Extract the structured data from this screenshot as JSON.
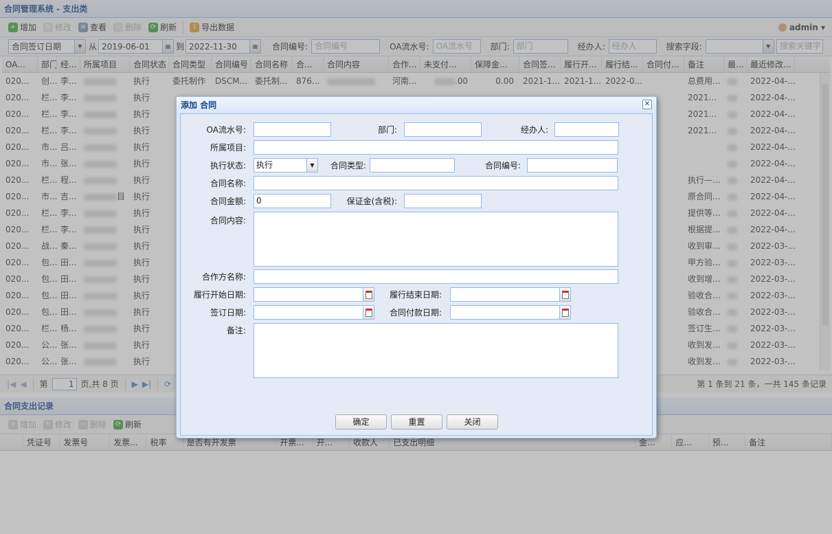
{
  "top_panel": {
    "title": "合同管理系统 - 支出类"
  },
  "toolbar": {
    "items": [
      {
        "label": "增加",
        "icon": "plus-icon",
        "color": "#3aa53a",
        "disabled": false
      },
      {
        "label": "修改",
        "icon": "pencil-icon",
        "color": "#d9b440",
        "disabled": true
      },
      {
        "label": "查看",
        "icon": "view-icon",
        "color": "#7a8fb0",
        "disabled": false
      },
      {
        "label": "删除",
        "icon": "minus-icon",
        "color": "#e07070",
        "disabled": true
      },
      {
        "label": "刷新",
        "icon": "refresh-icon",
        "color": "#3aa53a",
        "disabled": false
      },
      {
        "label": "导出数据",
        "icon": "export-icon",
        "color": "#d9a030",
        "disabled": false
      }
    ],
    "user": "admin ▾"
  },
  "search": {
    "date_field": "合同签订日期",
    "from_label": "从",
    "from_date": "2019-06-01",
    "to_label": "到",
    "to_date": "2022-11-30",
    "contract_no_label": "合同编号:",
    "contract_no_ph": "合同编号",
    "oa_label": "OA流水号:",
    "oa_ph": "OA流水号",
    "dept_label": "部门:",
    "dept_ph": "部门",
    "handler_label": "经办人:",
    "handler_ph": "经办人",
    "field_label": "搜索字段:",
    "keyword_ph": "搜索关键字"
  },
  "grid": {
    "columns": [
      "OA...",
      "部门",
      "经...",
      "所属项目",
      "合同状态",
      "合同类型",
      "合同编号",
      "合同名称",
      "合...",
      "合同内容",
      "合作...",
      "未支付...",
      "保障金...",
      "合同签...",
      "履行开...",
      "履行结...",
      "合同付...",
      "备注",
      "最...",
      "最近修改..."
    ],
    "rows": [
      [
        "020...",
        "创...",
        "李...",
        "",
        "执行",
        "委托制作",
        "DSCM...",
        "委托制...",
        "876...",
        "",
        "河南...",
        ".00",
        "0.00",
        "2021-1...",
        "2021-1...",
        "2022-0...",
        "",
        "总费用...",
        "",
        "2022-04-..."
      ],
      [
        "020...",
        "栏...",
        "李...",
        "",
        "执行",
        "",
        "",
        "",
        "",
        "",
        "",
        "",
        "",
        "",
        "",
        "",
        "",
        "2021...",
        "",
        "2022-04-..."
      ],
      [
        "020...",
        "栏...",
        "李...",
        "",
        "执行",
        "",
        "",
        "",
        "",
        "",
        "",
        "",
        "",
        "",
        "",
        "",
        "",
        "2021...",
        "",
        "2022-04-..."
      ],
      [
        "020...",
        "栏...",
        "李...",
        "",
        "执行",
        "",
        "",
        "",
        "",
        "",
        "",
        "",
        "",
        "",
        "",
        "",
        "",
        "2021...",
        "",
        "2022-04-..."
      ],
      [
        "020...",
        "市...",
        "吕...",
        "",
        "执行",
        "",
        "",
        "",
        "",
        "",
        "",
        "",
        "",
        "",
        "",
        "",
        "",
        "",
        "",
        "2022-04-..."
      ],
      [
        "020...",
        "市...",
        "张...",
        "",
        "执行",
        "",
        "",
        "",
        "",
        "",
        "",
        "",
        "",
        "",
        "",
        "",
        "",
        "",
        "",
        "2022-04-..."
      ],
      [
        "020...",
        "栏...",
        "程...",
        "",
        "执行",
        "",
        "",
        "",
        "",
        "",
        "",
        "",
        "",
        "",
        "",
        "",
        "",
        "执行—...",
        "",
        "2022-04-..."
      ],
      [
        "020...",
        "市...",
        "吉...",
        "目",
        "执行",
        "",
        "",
        "",
        "",
        "",
        "",
        "",
        "",
        "",
        "",
        "",
        "",
        "原合同...",
        "",
        "2022-04-..."
      ],
      [
        "020...",
        "栏...",
        "李...",
        "",
        "执行",
        "",
        "",
        "",
        "",
        "",
        "",
        "",
        "",
        "",
        "",
        "",
        "",
        "提供等...",
        "",
        "2022-04-..."
      ],
      [
        "020...",
        "栏...",
        "李...",
        "",
        "执行",
        "",
        "",
        "",
        "",
        "",
        "",
        "",
        "",
        "",
        "",
        "",
        "",
        "根据提...",
        "",
        "2022-04-..."
      ],
      [
        "020...",
        "战...",
        "秦...",
        "",
        "执行",
        "",
        "",
        "",
        "",
        "",
        "",
        "",
        "",
        "",
        "",
        "",
        "",
        "收到审...",
        "",
        "2022-03-..."
      ],
      [
        "020...",
        "包...",
        "田...",
        "",
        "执行",
        "",
        "",
        "",
        "",
        "",
        "",
        "",
        "",
        "",
        "",
        "",
        "",
        "甲方验...",
        "",
        "2022-03-..."
      ],
      [
        "020...",
        "包...",
        "田...",
        "",
        "执行",
        "",
        "",
        "",
        "",
        "",
        "",
        "",
        "",
        "",
        "",
        "",
        "",
        "收到增...",
        "",
        "2022-03-..."
      ],
      [
        "020...",
        "包...",
        "田...",
        "",
        "执行",
        "",
        "",
        "",
        "",
        "",
        "",
        "",
        "",
        "",
        "",
        "",
        "",
        "验收合...",
        "",
        "2022-03-..."
      ],
      [
        "020...",
        "包...",
        "田...",
        "",
        "执行",
        "",
        "",
        "",
        "",
        "",
        "",
        "",
        "",
        "",
        "",
        "",
        "",
        "验收合...",
        "",
        "2022-03-..."
      ],
      [
        "020...",
        "栏...",
        "杨...",
        "",
        "执行",
        "",
        "",
        "",
        "",
        "",
        "",
        "",
        "",
        "",
        "",
        "",
        "",
        "签订生...",
        "",
        "2022-03-..."
      ],
      [
        "020...",
        "公...",
        "张...",
        "",
        "执行",
        "",
        "",
        "",
        "",
        "",
        "",
        "",
        "",
        "",
        "",
        "",
        "",
        "收到发...",
        "",
        "2022-03-..."
      ],
      [
        "020...",
        "公...",
        "张...",
        "",
        "执行",
        "",
        "",
        "",
        "",
        "",
        "",
        "",
        "",
        "",
        "",
        "",
        "",
        "收到发...",
        "",
        "2022-03-..."
      ]
    ]
  },
  "pager": {
    "page_prefix": "第",
    "page": "1",
    "page_suffix": "页,共 8 页",
    "info": "第 1 条到 21 条，一共 145 条记录"
  },
  "bottom_panel": {
    "title": "合同支出记录",
    "toolbar": [
      {
        "label": "增加",
        "disabled": true,
        "color": "#3aa53a"
      },
      {
        "label": "修改",
        "disabled": true,
        "color": "#d9b440"
      },
      {
        "label": "删除",
        "disabled": true,
        "color": "#e07070"
      },
      {
        "label": "刷新",
        "disabled": false,
        "color": "#3aa53a"
      }
    ],
    "columns": [
      "凭证号",
      "发票号",
      "发票...",
      "税率",
      "是否有开发票",
      "开票...",
      "开...",
      "收款人",
      "已支出明细",
      "金...",
      "应...",
      "预...",
      "备注"
    ]
  },
  "dialog": {
    "title": "添加 合同",
    "labels": {
      "oa": "OA流水号:",
      "dept": "部门:",
      "handler": "经办人:",
      "project": "所属项目:",
      "status": "执行状态:",
      "type": "合同类型:",
      "no": "合同编号:",
      "name": "合同名称:",
      "amount": "合同金额:",
      "deposit": "保证金(含税):",
      "content": "合同内容:",
      "partner": "合作方名称:",
      "start": "履行开始日期:",
      "end": "履行结束日期:",
      "sign": "签订日期:",
      "pay": "合同付款日期:",
      "remark": "备注:"
    },
    "status_value": "执行",
    "amount_value": "0",
    "buttons": {
      "ok": "确定",
      "reset": "重置",
      "close": "关闭"
    }
  }
}
